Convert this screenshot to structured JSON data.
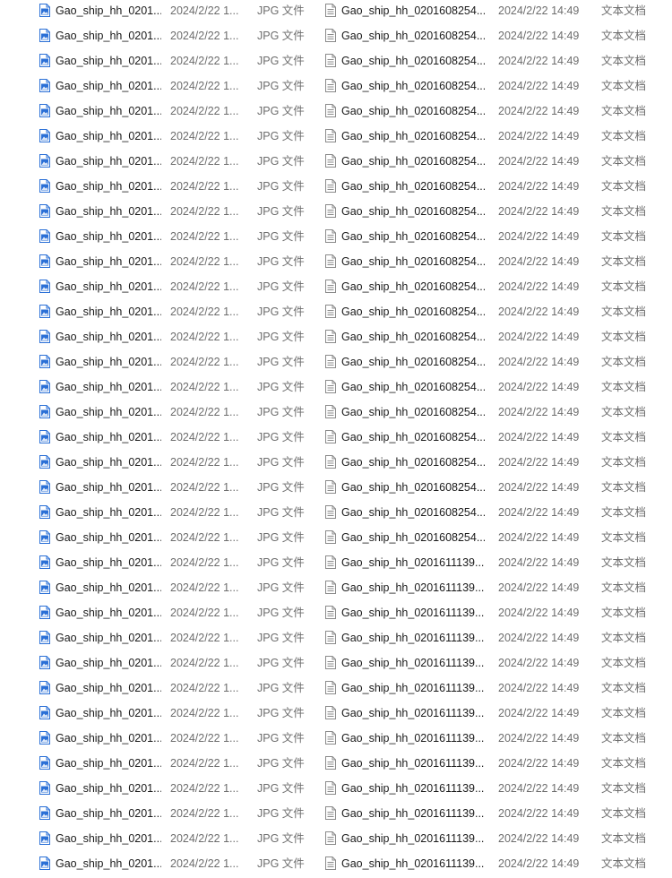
{
  "colors": {
    "jpg_icon": "#2a6fd6",
    "txt_icon": "#8a8a8a",
    "secondary_text": "#6d6d6d"
  },
  "left_list": {
    "icon": "jpg-file-icon",
    "name": "Gao_ship_hh_0201...",
    "date": "2024/2/22 1...",
    "type": "JPG 文件",
    "row_count": 35
  },
  "right_list": {
    "icon": "text-file-icon",
    "rows": [
      {
        "name": "Gao_ship_hh_0201608254...",
        "date": "2024/2/22 14:49",
        "type": "文本文档"
      },
      {
        "name": "Gao_ship_hh_0201608254...",
        "date": "2024/2/22 14:49",
        "type": "文本文档"
      },
      {
        "name": "Gao_ship_hh_0201608254...",
        "date": "2024/2/22 14:49",
        "type": "文本文档"
      },
      {
        "name": "Gao_ship_hh_0201608254...",
        "date": "2024/2/22 14:49",
        "type": "文本文档"
      },
      {
        "name": "Gao_ship_hh_0201608254...",
        "date": "2024/2/22 14:49",
        "type": "文本文档"
      },
      {
        "name": "Gao_ship_hh_0201608254...",
        "date": "2024/2/22 14:49",
        "type": "文本文档"
      },
      {
        "name": "Gao_ship_hh_0201608254...",
        "date": "2024/2/22 14:49",
        "type": "文本文档"
      },
      {
        "name": "Gao_ship_hh_0201608254...",
        "date": "2024/2/22 14:49",
        "type": "文本文档"
      },
      {
        "name": "Gao_ship_hh_0201608254...",
        "date": "2024/2/22 14:49",
        "type": "文本文档"
      },
      {
        "name": "Gao_ship_hh_0201608254...",
        "date": "2024/2/22 14:49",
        "type": "文本文档"
      },
      {
        "name": "Gao_ship_hh_0201608254...",
        "date": "2024/2/22 14:49",
        "type": "文本文档"
      },
      {
        "name": "Gao_ship_hh_0201608254...",
        "date": "2024/2/22 14:49",
        "type": "文本文档"
      },
      {
        "name": "Gao_ship_hh_0201608254...",
        "date": "2024/2/22 14:49",
        "type": "文本文档"
      },
      {
        "name": "Gao_ship_hh_0201608254...",
        "date": "2024/2/22 14:49",
        "type": "文本文档"
      },
      {
        "name": "Gao_ship_hh_0201608254...",
        "date": "2024/2/22 14:49",
        "type": "文本文档"
      },
      {
        "name": "Gao_ship_hh_0201608254...",
        "date": "2024/2/22 14:49",
        "type": "文本文档"
      },
      {
        "name": "Gao_ship_hh_0201608254...",
        "date": "2024/2/22 14:49",
        "type": "文本文档"
      },
      {
        "name": "Gao_ship_hh_0201608254...",
        "date": "2024/2/22 14:49",
        "type": "文本文档"
      },
      {
        "name": "Gao_ship_hh_0201608254...",
        "date": "2024/2/22 14:49",
        "type": "文本文档"
      },
      {
        "name": "Gao_ship_hh_0201608254...",
        "date": "2024/2/22 14:49",
        "type": "文本文档"
      },
      {
        "name": "Gao_ship_hh_0201608254...",
        "date": "2024/2/22 14:49",
        "type": "文本文档"
      },
      {
        "name": "Gao_ship_hh_0201608254...",
        "date": "2024/2/22 14:49",
        "type": "文本文档"
      },
      {
        "name": "Gao_ship_hh_0201611139...",
        "date": "2024/2/22 14:49",
        "type": "文本文档"
      },
      {
        "name": "Gao_ship_hh_0201611139...",
        "date": "2024/2/22 14:49",
        "type": "文本文档"
      },
      {
        "name": "Gao_ship_hh_0201611139...",
        "date": "2024/2/22 14:49",
        "type": "文本文档"
      },
      {
        "name": "Gao_ship_hh_0201611139...",
        "date": "2024/2/22 14:49",
        "type": "文本文档"
      },
      {
        "name": "Gao_ship_hh_0201611139...",
        "date": "2024/2/22 14:49",
        "type": "文本文档"
      },
      {
        "name": "Gao_ship_hh_0201611139...",
        "date": "2024/2/22 14:49",
        "type": "文本文档"
      },
      {
        "name": "Gao_ship_hh_0201611139...",
        "date": "2024/2/22 14:49",
        "type": "文本文档"
      },
      {
        "name": "Gao_ship_hh_0201611139...",
        "date": "2024/2/22 14:49",
        "type": "文本文档"
      },
      {
        "name": "Gao_ship_hh_0201611139...",
        "date": "2024/2/22 14:49",
        "type": "文本文档"
      },
      {
        "name": "Gao_ship_hh_0201611139...",
        "date": "2024/2/22 14:49",
        "type": "文本文档"
      },
      {
        "name": "Gao_ship_hh_0201611139...",
        "date": "2024/2/22 14:49",
        "type": "文本文档"
      },
      {
        "name": "Gao_ship_hh_0201611139...",
        "date": "2024/2/22 14:49",
        "type": "文本文档"
      },
      {
        "name": "Gao_ship_hh_0201611139...",
        "date": "2024/2/22 14:49",
        "type": "文本文档"
      }
    ]
  }
}
